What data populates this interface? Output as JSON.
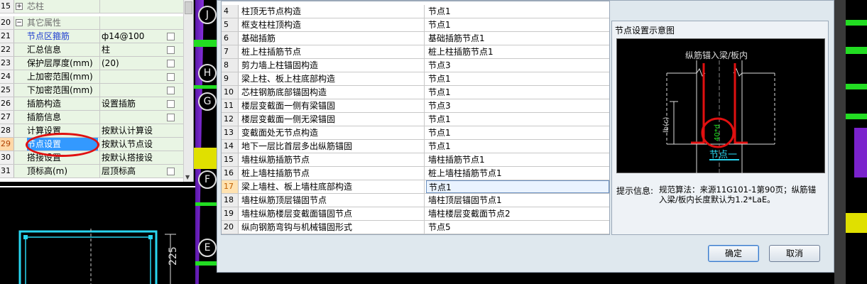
{
  "left_panel": {
    "rows": [
      {
        "num": "15",
        "expander": "+",
        "name": "芯柱",
        "value": "",
        "checkbox": false,
        "style": "cat",
        "selected": false
      },
      {
        "num": "20",
        "expander": "−",
        "name": "其它属性",
        "value": "",
        "checkbox": false,
        "style": "cat",
        "selected": false
      },
      {
        "num": "21",
        "expander": "",
        "name": "节点区箍筋",
        "value": "ф14@100",
        "checkbox": true,
        "style": "blue",
        "selected": false
      },
      {
        "num": "22",
        "expander": "",
        "name": "汇总信息",
        "value": "柱",
        "checkbox": true,
        "style": "",
        "selected": false
      },
      {
        "num": "23",
        "expander": "",
        "name": "保护层厚度(mm)",
        "value": "(20)",
        "checkbox": true,
        "style": "",
        "selected": false
      },
      {
        "num": "24",
        "expander": "",
        "name": "上加密范围(mm)",
        "value": "",
        "checkbox": true,
        "style": "",
        "selected": false
      },
      {
        "num": "25",
        "expander": "",
        "name": "下加密范围(mm)",
        "value": "",
        "checkbox": true,
        "style": "",
        "selected": false
      },
      {
        "num": "26",
        "expander": "",
        "name": "插筋构造",
        "value": "设置插筋",
        "checkbox": true,
        "style": "",
        "selected": false
      },
      {
        "num": "27",
        "expander": "",
        "name": "插筋信息",
        "value": "",
        "checkbox": true,
        "style": "",
        "selected": false
      },
      {
        "num": "28",
        "expander": "",
        "name": "计算设置",
        "value": "按默认计算设",
        "checkbox": false,
        "style": "",
        "selected": false
      },
      {
        "num": "29",
        "expander": "",
        "name": "节点设置",
        "value": "按默认节点设",
        "checkbox": false,
        "style": "",
        "selected": true
      },
      {
        "num": "30",
        "expander": "",
        "name": "搭接设置",
        "value": "按默认搭接设",
        "checkbox": false,
        "style": "",
        "selected": false
      },
      {
        "num": "31",
        "expander": "",
        "name": "顶标高(m)",
        "value": "层顶标高",
        "checkbox": true,
        "style": "",
        "selected": false
      }
    ]
  },
  "cad": {
    "axis_labels": [
      "J",
      "H",
      "G",
      "F",
      "E"
    ],
    "dimension_text": "225",
    "colors": {
      "green": "#22dd22",
      "yellow": "#e0e000",
      "purple": "#7a22cc",
      "cyan": "#29d6f0",
      "red": "#e01010"
    }
  },
  "dialog": {
    "rows": [
      {
        "num": "4",
        "name": "柱顶无节点构造",
        "value": "节点1"
      },
      {
        "num": "5",
        "name": "框支柱柱顶构造",
        "value": "节点1"
      },
      {
        "num": "6",
        "name": "基础插筋",
        "value": "基础插筋节点1"
      },
      {
        "num": "7",
        "name": "桩上柱插筋节点",
        "value": "桩上柱插筋节点1"
      },
      {
        "num": "8",
        "name": "剪力墙上柱锚固构造",
        "value": "节点3"
      },
      {
        "num": "9",
        "name": "梁上柱、板上柱底部构造",
        "value": "节点1"
      },
      {
        "num": "10",
        "name": "芯柱钢筋底部锚固构造",
        "value": "节点1"
      },
      {
        "num": "11",
        "name": "楼层变截面一侧有梁锚固",
        "value": "节点3"
      },
      {
        "num": "12",
        "name": "楼层变截面一侧无梁锚固",
        "value": "节点1"
      },
      {
        "num": "13",
        "name": "变截面处无节点构造",
        "value": "节点1"
      },
      {
        "num": "14",
        "name": "地下一层比首层多出纵筋锚固",
        "value": "节点1"
      },
      {
        "num": "15",
        "name": "墙柱纵筋插筋节点",
        "value": "墙柱插筋节点1"
      },
      {
        "num": "16",
        "name": "桩上墙柱插筋节点",
        "value": "桩上墙柱插筋节点1"
      },
      {
        "num": "17",
        "name": "梁上墙柱、板上墙柱底部构造",
        "value": "节点1",
        "selected": true
      },
      {
        "num": "18",
        "name": "墙柱纵筋顶层锚固节点",
        "value": "墙柱顶层锚固节点1"
      },
      {
        "num": "19",
        "name": "墙柱纵筋楼层变截面锚固节点",
        "value": "墙柱楼层变截面节点2"
      },
      {
        "num": "20",
        "name": "纵向钢筋弯钩与机械锚固形式",
        "value": "节点5"
      }
    ],
    "node_panel_title": "节点设置示意图",
    "diagram": {
      "title": "纵筋锚入梁/板内",
      "lb_label": "lb(c)",
      "d_label": "40*d",
      "node_name": "节点一"
    },
    "hint_label": "提示信息:",
    "hint_text": "规范算法：来源11G101-1第90页；纵筋锚入梁/板内长度默认为1.2*LaE。",
    "ok_label": "确定",
    "cancel_label": "取消"
  }
}
